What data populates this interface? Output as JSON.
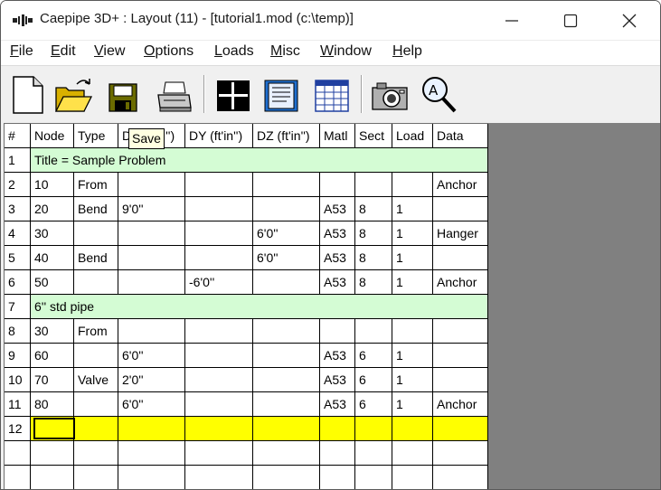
{
  "window": {
    "title": "Caepipe 3D+ : Layout  (11)  -  [tutorial1.mod (c:\\temp)]"
  },
  "menu": [
    {
      "label": "File",
      "accel": "F",
      "rest": "ile"
    },
    {
      "label": "Edit",
      "accel": "E",
      "rest": "dit"
    },
    {
      "label": "View",
      "accel": "V",
      "rest": "iew"
    },
    {
      "label": "Options",
      "accel": "O",
      "rest": "ptions"
    },
    {
      "label": "Loads",
      "accel": "L",
      "rest": "oads"
    },
    {
      "label": "Misc",
      "accel": "M",
      "rest": "isc"
    },
    {
      "label": "Window",
      "accel": "W",
      "rest": "indow"
    },
    {
      "label": "Help",
      "accel": "H",
      "rest": "elp"
    }
  ],
  "toolbar": {
    "buttons": [
      "new-file-icon",
      "open-folder-icon",
      "save-disk-icon",
      "print-icon",
      "crosshair-view-icon",
      "text-list-icon",
      "spreadsheet-icon",
      "camera-icon",
      "zoom-magnifier-icon"
    ],
    "tooltip": "Save"
  },
  "grid": {
    "headers": [
      "#",
      "Node",
      "Type",
      "D",
      "DY (ft'in'')",
      "DZ (ft'in'')",
      "Matl",
      "Sect",
      "Load",
      "Data"
    ],
    "header_dx_tail": "'')",
    "rows": [
      {
        "num": "1",
        "title": "Title = Sample Problem"
      },
      {
        "num": "2",
        "cells": [
          "10",
          "From",
          "",
          "",
          "",
          "",
          "",
          "",
          "Anchor"
        ]
      },
      {
        "num": "3",
        "cells": [
          "20",
          "Bend",
          "9'0''",
          "",
          "",
          "A53",
          "8",
          "1",
          ""
        ]
      },
      {
        "num": "4",
        "cells": [
          "30",
          "",
          "",
          "",
          "6'0''",
          "A53",
          "8",
          "1",
          "Hanger"
        ]
      },
      {
        "num": "5",
        "cells": [
          "40",
          "Bend",
          "",
          "",
          "6'0''",
          "A53",
          "8",
          "1",
          ""
        ]
      },
      {
        "num": "6",
        "cells": [
          "50",
          "",
          "",
          "-6'0''",
          "",
          "A53",
          "8",
          "1",
          "Anchor"
        ]
      },
      {
        "num": "7",
        "title": "6'' std pipe"
      },
      {
        "num": "8",
        "cells": [
          "30",
          "From",
          "",
          "",
          "",
          "",
          "",
          "",
          ""
        ]
      },
      {
        "num": "9",
        "cells": [
          "60",
          "",
          "6'0''",
          "",
          "",
          "A53",
          "6",
          "1",
          ""
        ]
      },
      {
        "num": "10",
        "cells": [
          "70",
          "Valve",
          "2'0''",
          "",
          "",
          "A53",
          "6",
          "1",
          ""
        ]
      },
      {
        "num": "11",
        "cells": [
          "80",
          "",
          "6'0''",
          "",
          "",
          "A53",
          "6",
          "1",
          "Anchor"
        ]
      },
      {
        "num": "12",
        "cells": [
          "",
          "",
          "",
          "",
          "",
          "",
          "",
          "",
          ""
        ],
        "selected": true
      },
      {
        "num": "",
        "cells": [
          "",
          "",
          "",
          "",
          "",
          "",
          "",
          "",
          ""
        ]
      },
      {
        "num": "",
        "cells": [
          "",
          "",
          "",
          "",
          "",
          "",
          "",
          "",
          ""
        ]
      }
    ]
  },
  "colors": {
    "title_row": "#d4fcd4",
    "selected_row": "#ffff00",
    "side_pane": "#808080"
  }
}
